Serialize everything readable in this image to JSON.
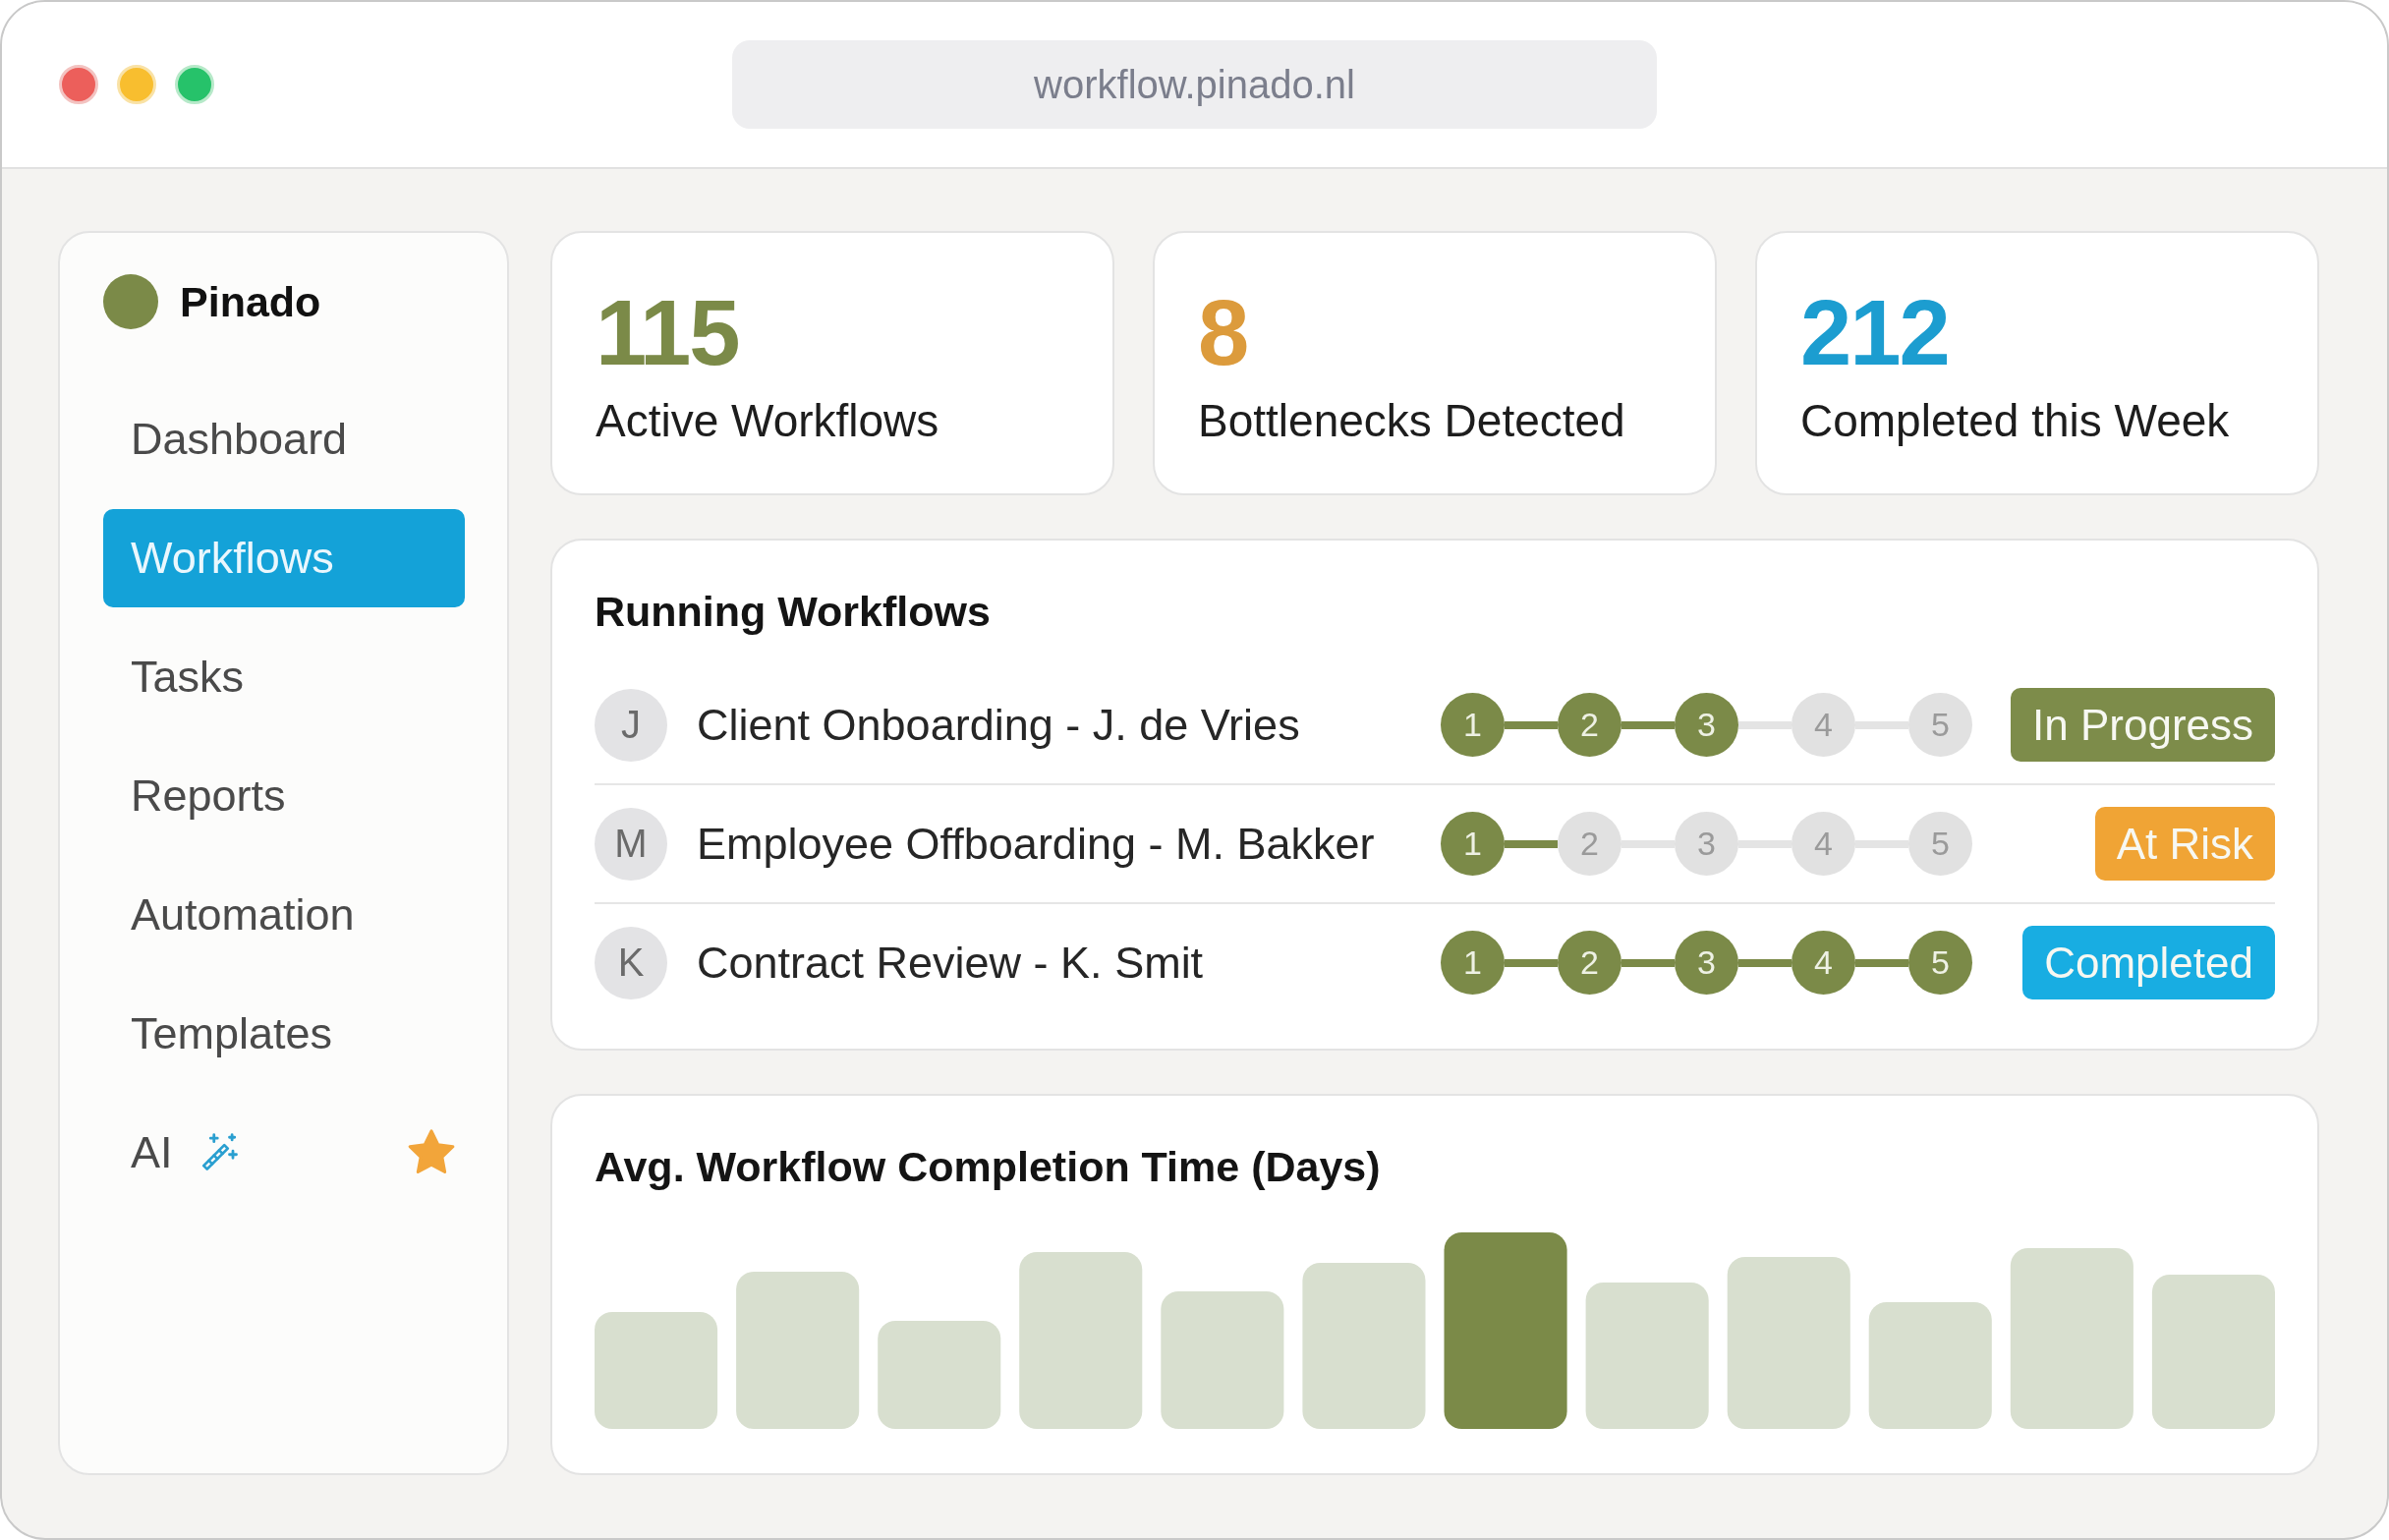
{
  "browser": {
    "address": "workflow.pinado.nl"
  },
  "sidebar": {
    "brand": "Pinado",
    "items": [
      {
        "label": "Dashboard",
        "selected": false,
        "kind": "link"
      },
      {
        "label": "Workflows",
        "selected": true,
        "kind": "link"
      },
      {
        "label": "Tasks",
        "selected": false,
        "kind": "link"
      },
      {
        "label": "Reports",
        "selected": false,
        "kind": "link"
      },
      {
        "label": "Automation",
        "selected": false,
        "kind": "link"
      },
      {
        "label": "Templates",
        "selected": false,
        "kind": "link"
      },
      {
        "label": "AI",
        "selected": false,
        "kind": "ai"
      }
    ]
  },
  "stats": [
    {
      "value": "115",
      "label": "Active Workflows",
      "color": "#7b8a48"
    },
    {
      "value": "8",
      "label": "Bottlenecks Detected",
      "color": "#dc9b3c"
    },
    {
      "value": "212",
      "label": "Completed this Week",
      "color": "#1c9dd0"
    }
  ],
  "running_workflows": {
    "title": "Running Workflows",
    "rows": [
      {
        "initial": "J",
        "name": "Client Onboarding - J. de Vries",
        "steps": [
          {
            "label": "1",
            "done": true
          },
          {
            "label": "2",
            "done": true
          },
          {
            "label": "3",
            "done": true
          },
          {
            "label": "4",
            "done": false
          },
          {
            "label": "5",
            "done": false
          }
        ],
        "links": [
          {
            "done": true
          },
          {
            "done": true
          },
          {
            "done": false
          },
          {
            "done": false
          }
        ],
        "status": {
          "label": "In Progress",
          "color": "#7d8c4a"
        }
      },
      {
        "initial": "M",
        "name": "Employee Offboarding - M. Bakker",
        "steps": [
          {
            "label": "1",
            "done": true
          },
          {
            "label": "2",
            "done": false
          },
          {
            "label": "3",
            "done": false
          },
          {
            "label": "4",
            "done": false
          },
          {
            "label": "5",
            "done": false
          }
        ],
        "links": [
          {
            "done": true
          },
          {
            "done": false
          },
          {
            "done": false
          },
          {
            "done": false
          }
        ],
        "status": {
          "label": "At Risk",
          "color": "#f0a435"
        }
      },
      {
        "initial": "K",
        "name": "Contract Review - K. Smit",
        "steps": [
          {
            "label": "1",
            "done": true
          },
          {
            "label": "2",
            "done": true
          },
          {
            "label": "3",
            "done": true
          },
          {
            "label": "4",
            "done": true
          },
          {
            "label": "5",
            "done": true
          }
        ],
        "links": [
          {
            "done": true
          },
          {
            "done": true
          },
          {
            "done": true
          },
          {
            "done": true
          }
        ],
        "status": {
          "label": "Completed",
          "color": "#18ade2"
        }
      }
    ]
  },
  "completion_chart": {
    "title": "Avg. Workflow Completion Time (Days)"
  }
}
